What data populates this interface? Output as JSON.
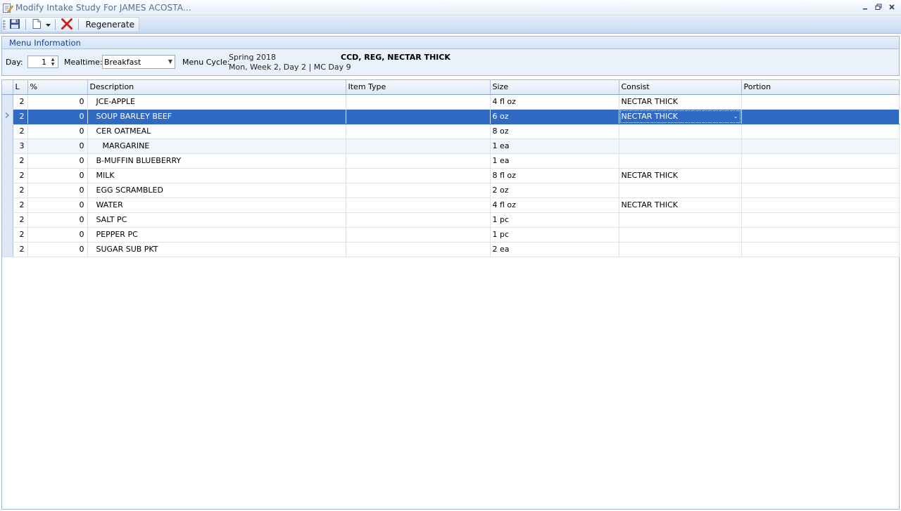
{
  "window": {
    "title": "Modify Intake Study For JAMES ACOSTA..."
  },
  "toolbar": {
    "save_icon": "floppy-disk-icon",
    "new_icon": "new-document-icon",
    "delete_icon": "red-x-icon",
    "regenerate_label": "Regenerate"
  },
  "menu_info": {
    "title": "Menu Information",
    "day_label": "Day:",
    "day_value": "1",
    "mealtime_label": "Mealtime:",
    "mealtime_value": "Breakfast",
    "menu_cycle_label": "Menu Cycle:",
    "menu_cycle_line1": "Spring 2018",
    "menu_cycle_line2": "Mon, Week 2, Day 2 | MC Day 9",
    "diet": "CCD, REG, NECTAR THICK"
  },
  "grid": {
    "columns": [
      "L",
      "%",
      "Description",
      "Item Type",
      "Size",
      "Consist",
      "Portion"
    ],
    "rows": [
      {
        "l": "2",
        "pct": "0",
        "desc": "JCE-APPLE",
        "type": "",
        "size": "4 fl oz",
        "consist": "NECTAR THICK",
        "portion": ""
      },
      {
        "l": "2",
        "pct": "0",
        "desc": "SOUP BARLEY BEEF",
        "type": "",
        "size": "6 oz",
        "consist": "NECTAR THICK",
        "portion": ""
      },
      {
        "l": "2",
        "pct": "0",
        "desc": "CER OATMEAL",
        "type": "",
        "size": "8 oz",
        "consist": "",
        "portion": ""
      },
      {
        "l": "3",
        "pct": "0",
        "desc": "MARGARINE",
        "type": "",
        "size": "1 ea",
        "consist": "",
        "portion": ""
      },
      {
        "l": "2",
        "pct": "0",
        "desc": "B-MUFFIN BLUEBERRY",
        "type": "",
        "size": "1 ea",
        "consist": "",
        "portion": ""
      },
      {
        "l": "2",
        "pct": "0",
        "desc": "MILK",
        "type": "",
        "size": "8 fl oz",
        "consist": "NECTAR THICK",
        "portion": ""
      },
      {
        "l": "2",
        "pct": "0",
        "desc": "EGG SCRAMBLED",
        "type": "",
        "size": "2 oz",
        "consist": "",
        "portion": ""
      },
      {
        "l": "2",
        "pct": "0",
        "desc": "WATER",
        "type": "",
        "size": "4 fl oz",
        "consist": "NECTAR THICK",
        "portion": ""
      },
      {
        "l": "2",
        "pct": "0",
        "desc": "SALT PC",
        "type": "",
        "size": "1 pc",
        "consist": "",
        "portion": ""
      },
      {
        "l": "2",
        "pct": "0",
        "desc": "PEPPER PC",
        "type": "",
        "size": "1 pc",
        "consist": "",
        "portion": ""
      },
      {
        "l": "2",
        "pct": "0",
        "desc": "SUGAR SUB PKT",
        "type": "",
        "size": "2 ea",
        "consist": "",
        "portion": ""
      }
    ]
  },
  "colors": {
    "selection": "#316ac5",
    "panel_title": "#15428b"
  }
}
